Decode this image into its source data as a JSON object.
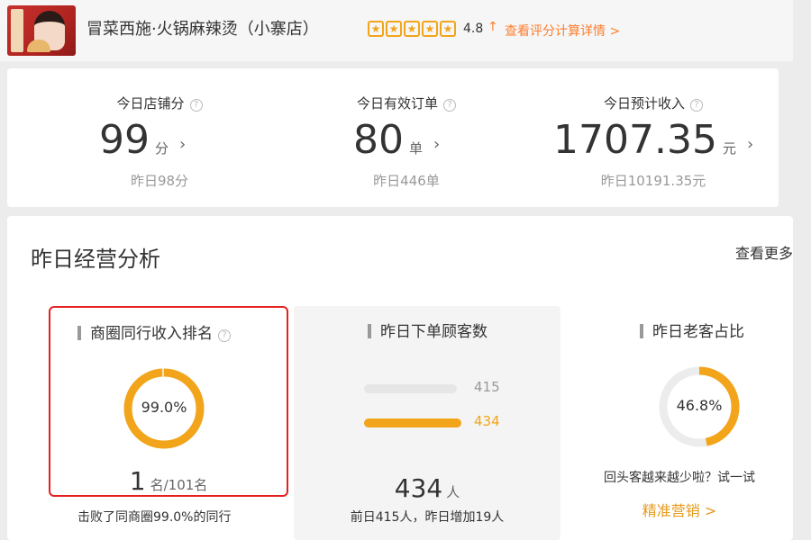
{
  "header": {
    "shop_name": "冒菜西施·火锅麻辣烫（小寨店）",
    "rating": "4.8",
    "rating_arrow": "↑",
    "rating_link": "查看评分计算详情 >",
    "star_icon": "star-icon",
    "star_count": 5
  },
  "stats": [
    {
      "title": "今日店铺分",
      "value": "99",
      "unit": "分",
      "sub": "昨日98分"
    },
    {
      "title": "今日有效订单",
      "value": "80",
      "unit": "单",
      "sub": "昨日446单"
    },
    {
      "title": "今日预计收入",
      "value": "1707.35",
      "unit": "元",
      "sub": "昨日10191.35元"
    }
  ],
  "analysis": {
    "title": "昨日经营分析",
    "more": "查看更多",
    "rank_panel": {
      "title": "商圈同行收入排名",
      "percent_label": "99.0%",
      "percent_value": 0.99,
      "rank": "1",
      "rank_suffix": "名/101名",
      "beat_text": "击败了同商圈99.0%的同行"
    },
    "customers_panel": {
      "title": "昨日下单顾客数",
      "bars": [
        {
          "value": 415,
          "label": "415",
          "color": "#e6e6e6",
          "label_color": "#999999"
        },
        {
          "value": 434,
          "label": "434",
          "color": "#f2a51a",
          "label_color": "#f2a51a"
        }
      ],
      "count": "434",
      "count_unit": "人",
      "note": "前日415人，昨日增加19人"
    },
    "returning_panel": {
      "title": "昨日老客占比",
      "percent_label": "46.8%",
      "percent_value": 0.468,
      "text": "回头客越来越少啦？试一试",
      "link": "精准营销 >"
    }
  },
  "colors": {
    "accent": "#f2a51a",
    "highlight_border": "#e52020",
    "link_orange": "#ff7d2c"
  }
}
